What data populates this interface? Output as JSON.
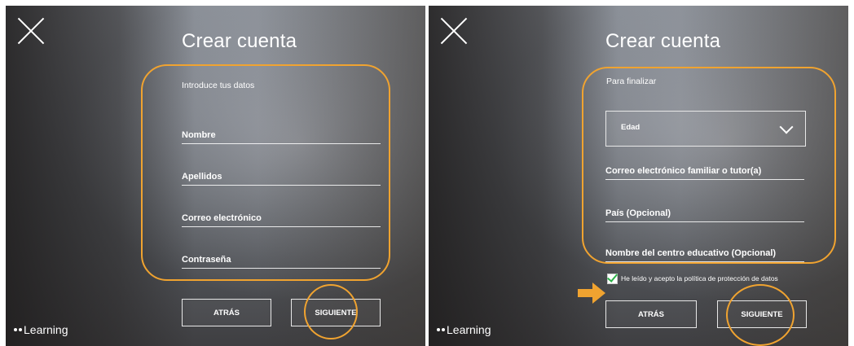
{
  "left": {
    "title": "Crear cuenta",
    "subtitle": "Introduce tus datos",
    "fields": [
      "Nombre",
      "Apellidos",
      "Correo electrónico",
      "Contraseña"
    ],
    "back_label": "ATRÁS",
    "next_label": "SIGUIENTE",
    "brand": "Learning"
  },
  "right": {
    "title": "Crear cuenta",
    "subtitle": "Para finalizar",
    "age_select": "Edad",
    "fields": [
      "Correo electrónico familiar o tutor(a)",
      "País (Opcional)",
      "Nombre del centro educativo (Opcional)"
    ],
    "consent_label": "He leído y acepto la política de protección de datos",
    "consent_checked": true,
    "back_label": "ATRÁS",
    "next_label": "SIGUIENTE",
    "brand": "Learning"
  },
  "colors": {
    "highlight": "#f0a330",
    "check": "#2db24a"
  },
  "icons": [
    "close-icon",
    "chevron-down-icon",
    "arrow-right-icon",
    "checkmark-icon"
  ]
}
